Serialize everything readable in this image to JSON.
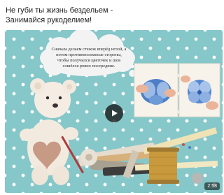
{
  "post": {
    "text_line_1": "Не губи ты жизнь бездельем -",
    "text_line_2": "Занимайся рукоделием!"
  },
  "video": {
    "caption": "Сначала делаем стежок вперёд иглой, а потом противоположные стороны, чтобы получился цветочек и шов сошёлся ровно посередине.",
    "duration": "2:58"
  },
  "icons": {
    "play": "play-icon"
  }
}
